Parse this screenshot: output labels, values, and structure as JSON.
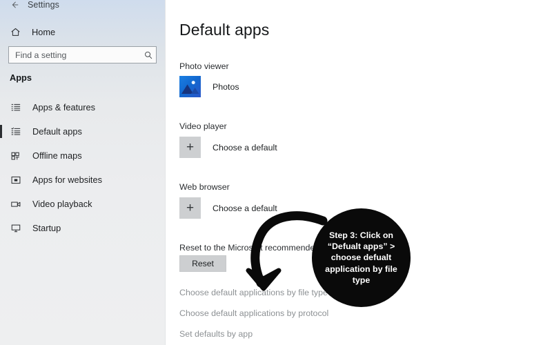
{
  "sidebar": {
    "app_title": "Settings",
    "back_icon": "back-arrow-icon",
    "home": {
      "label": "Home",
      "icon": "home-icon"
    },
    "search": {
      "value": "",
      "placeholder": "Find a setting",
      "icon": "search-icon"
    },
    "group_title": "Apps",
    "items": [
      {
        "label": "Apps & features",
        "icon": "list-icon",
        "selected": false
      },
      {
        "label": "Default apps",
        "icon": "list-check-icon",
        "selected": true
      },
      {
        "label": "Offline maps",
        "icon": "map-icon",
        "selected": false
      },
      {
        "label": "Apps for websites",
        "icon": "app-window-icon",
        "selected": false
      },
      {
        "label": "Video playback",
        "icon": "video-camera-icon",
        "selected": false
      },
      {
        "label": "Startup",
        "icon": "monitor-icon",
        "selected": false
      }
    ]
  },
  "main": {
    "title": "Default apps",
    "sections": [
      {
        "label": "Photo viewer",
        "app_name": "Photos",
        "icon": "photos-app-icon",
        "kind": "app"
      },
      {
        "label": "Video player",
        "app_name": "Choose a default",
        "icon": "plus-icon",
        "kind": "empty"
      },
      {
        "label": "Web browser",
        "app_name": "Choose a default",
        "icon": "plus-icon",
        "kind": "empty"
      }
    ],
    "reset": {
      "label": "Reset to the Microsoft recommended defaults",
      "button_label": "Reset"
    },
    "links": [
      "Choose default applications by file type",
      "Choose default applications by protocol",
      "Set defaults by app"
    ]
  },
  "annotation": {
    "text": "Step 3: Click on “Defualt apps” > choose defualt application by file type",
    "circle_color": "#0a0a0a",
    "text_color": "#ffffff",
    "arrow_icon": "curved-down-arrow-icon"
  },
  "colors": {
    "accent_blue": "#1268cf",
    "sidebar_top": "#cfdced",
    "sidebar_bottom": "#eeeff0",
    "link_gray": "#8d9194",
    "tile_gray": "#cdcfd1"
  }
}
